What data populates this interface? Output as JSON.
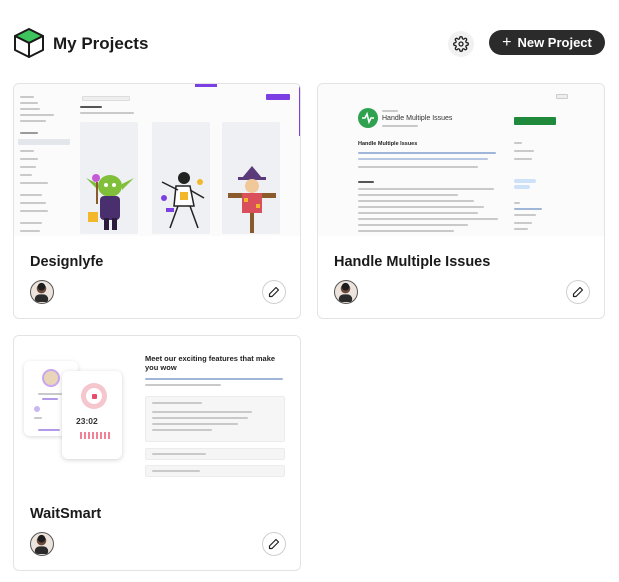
{
  "header": {
    "title": "My Projects",
    "new_project_label": "New Project",
    "logo_icon": "cube-logo-icon",
    "settings_icon": "gear-icon"
  },
  "projects": [
    {
      "title": "Designlyfe",
      "edit_icon": "pencil-icon",
      "avatar": "user-avatar"
    },
    {
      "title": "Handle Multiple Issues",
      "edit_icon": "pencil-icon",
      "avatar": "user-avatar"
    },
    {
      "title": "WaitSmart",
      "edit_icon": "pencil-icon",
      "avatar": "user-avatar"
    }
  ],
  "thumbnails": {
    "issue_title": "Handle Multiple Issues",
    "waitsmart_heading": "Meet our exciting features that make you wow",
    "waitsmart_time": "23:02"
  },
  "colors": {
    "accent_dark": "#2b2b2b",
    "logo_green": "#3ec45c",
    "purple": "#7b3fe4",
    "github_green": "#2fa24f",
    "pink": "#e94b6a"
  }
}
